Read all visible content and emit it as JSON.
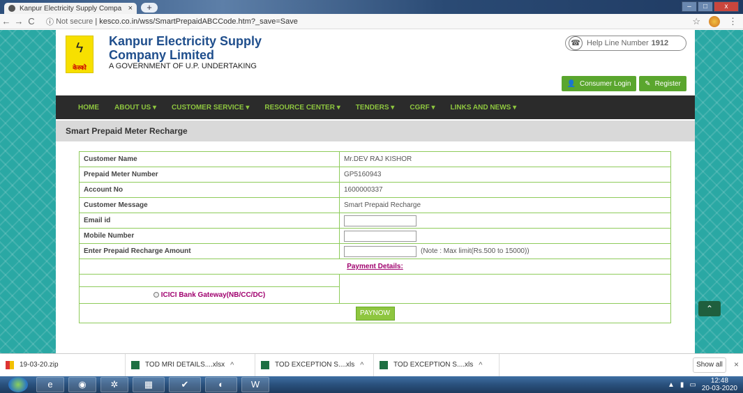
{
  "browser": {
    "tab_title": "Kanpur Electricity Supply Compa",
    "tab_close": "×",
    "new_tab": "+",
    "security": "Not secure",
    "url": "kesco.co.in/wss/SmartPrepaidABCCode.htm?_save=Save",
    "nav_back": "←",
    "nav_forward": "→",
    "nav_reload": "C",
    "info_icon": "ⓘ",
    "star": "☆",
    "menu": "⋮",
    "win_min": "–",
    "win_max": "□",
    "win_close": "x"
  },
  "header": {
    "logo_glyph": "ϟ",
    "logo_text": "केस्को",
    "brand_line1": "Kanpur Electricity Supply",
    "brand_line2": "Company Limited",
    "brand_line3": "A GOVERNMENT OF U.P. UNDERTAKING",
    "helpline_label": "Help Line Number",
    "helpline_number": "1912",
    "consumer_login": "Consumer Login",
    "register": "Register"
  },
  "menu": {
    "items": [
      "HOME",
      "ABOUT US ▾",
      "CUSTOMER SERVICE ▾",
      "RESOURCE CENTER ▾",
      "TENDERS ▾",
      "CGRF ▾",
      "LINKS AND NEWS ▾"
    ]
  },
  "page_title": "Smart Prepaid Meter Recharge",
  "form": {
    "rows": [
      {
        "label": "Customer Name",
        "value": "Mr.DEV RAJ KISHOR"
      },
      {
        "label": "Prepaid Meter Number",
        "value": "GP5160943"
      },
      {
        "label": "Account No",
        "value": "1600000337"
      },
      {
        "label": "Customer Message",
        "value": "Smart Prepaid Recharge"
      }
    ],
    "email_label": "Email id",
    "email_value": "",
    "mobile_label": "Mobile Number",
    "mobile_value": "",
    "amount_label": "Enter Prepaid Recharge Amount",
    "amount_value": "",
    "amount_note": "(Note : Max limit(Rs.500 to 15000))",
    "payment_details": "Payment Details:",
    "gateway": "ICICI Bank Gateway(NB/CC/DC)",
    "paynow": "PAYNOW"
  },
  "downloads": {
    "items": [
      {
        "name": "19-03-20.zip"
      },
      {
        "name": "TOD MRI DETAILS....xlsx"
      },
      {
        "name": "TOD EXCEPTION S....xls"
      },
      {
        "name": "TOD EXCEPTION S....xls"
      }
    ],
    "caret": "^",
    "show_all": "Show all",
    "close": "×"
  },
  "taskbar": {
    "time": "12:48",
    "date": "20-03-2020"
  },
  "colors": {
    "brand_blue": "#1f4e8c",
    "menu_green": "#8ec63f",
    "button_green": "#5aa62e",
    "border_green": "#8ecb5a",
    "link_magenta": "#a0006e"
  }
}
